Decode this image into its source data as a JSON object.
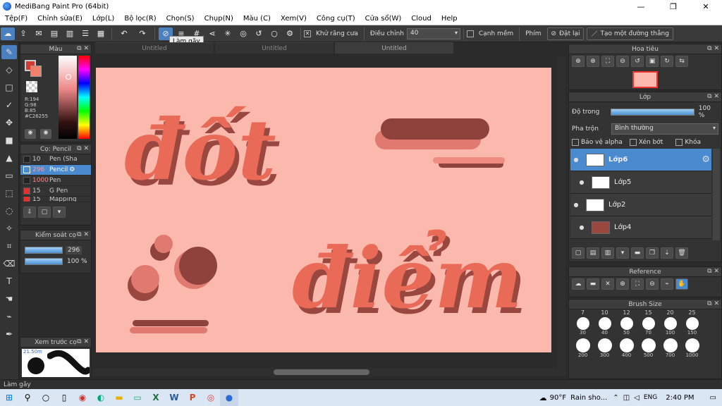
{
  "window": {
    "title": "MediBang Paint Pro (64bit)",
    "min": "—",
    "max": "❐",
    "close": "✕"
  },
  "menu": [
    "Tệp(F)",
    "Chỉnh sửa(E)",
    "Lớp(L)",
    "Bộ lọc(R)",
    "Chọn(S)",
    "Chụp(N)",
    "Màu (C)",
    "Xem(V)",
    "Công cụ(T)",
    "Cửa sổ(W)",
    "Cloud",
    "Help"
  ],
  "toolbar": {
    "antialias_label": "Khử răng cưa",
    "adjust_label": "Điều chỉnh",
    "adjust_value": "40",
    "soft_edge_label": "Cạnh mềm",
    "key_label": "Phím",
    "reset_label": "Đặt lại",
    "straight_label": "Tạo một đường thẳng",
    "tooltip": "Làm gãy"
  },
  "tabs": [
    "Untitled",
    "Untitled",
    "Untitled"
  ],
  "color_panel": {
    "title": "Màu",
    "primary": "#C26255",
    "readout": {
      "r": "R:194",
      "g": "G:98",
      "b": "B:85",
      "hex": "#C26255"
    }
  },
  "brush_panel": {
    "title": "Cọ: Pencil",
    "items": [
      {
        "size": "10",
        "name": "Pen (Sha",
        "color": "#222222"
      },
      {
        "size": "296",
        "name": "Pencil",
        "color": "#4a8bd0"
      },
      {
        "size": "1000",
        "name": "Pen",
        "color": "#222222"
      },
      {
        "size": "15",
        "name": "G Pen",
        "color": "#d33"
      },
      {
        "size": "15",
        "name": "Mapping",
        "color": "#d33"
      }
    ]
  },
  "brush_control": {
    "title": "Kiểm soát cọ",
    "size": "296",
    "opacity": "100 %"
  },
  "preview_panel": {
    "title": "Xem trước cọ",
    "size_note": "21.50m"
  },
  "navigator": {
    "title": "Hoa tiêu"
  },
  "layer_panel": {
    "title": "Lớp",
    "opacity_label": "Độ trong",
    "opacity_value": "100 %",
    "blend_label": "Pha trộn",
    "blend_value": "Bình thường",
    "protect_alpha": "Bảo vệ alpha",
    "clipping": "Xén bớt",
    "lock": "Khóa",
    "layers": [
      {
        "name": "Lớp6",
        "selected": true
      },
      {
        "name": "Lớp5",
        "selected": false
      },
      {
        "name": "Lớp2",
        "selected": false
      },
      {
        "name": "Lớp4",
        "selected": false
      }
    ]
  },
  "reference": {
    "title": "Reference"
  },
  "brush_size": {
    "title": "Brush Size",
    "row0": [
      "7",
      "10",
      "12",
      "15",
      "20",
      "25"
    ],
    "row1": [
      "30",
      "40",
      "50",
      "70",
      "100",
      "150"
    ],
    "row2": [
      "200",
      "300",
      "400",
      "500",
      "700",
      "1000"
    ]
  },
  "status": "Làm gãy",
  "taskbar": {
    "weather": "90°F",
    "weather_text": "Rain sho...",
    "lang": "ENG",
    "time": "2:40 PM"
  },
  "canvas": {
    "text1": "đốt",
    "text2": "điểm",
    "colors": {
      "bg": "#fbb8ad",
      "letter": "#ea6a58",
      "shadow": "#9a4740",
      "dark": "#8f423c",
      "mid": "#e07a70"
    }
  }
}
